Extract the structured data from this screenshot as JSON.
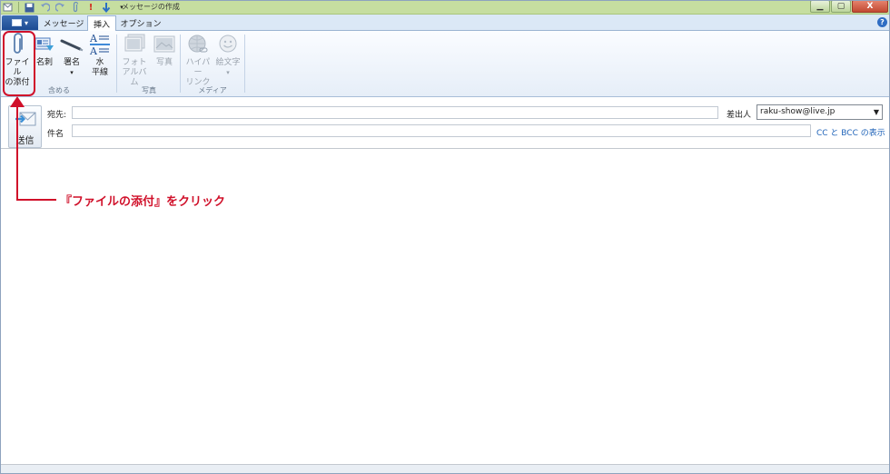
{
  "window": {
    "title": "メッセージの作成"
  },
  "title_buttons": {
    "minimize": "▁",
    "maximize": "▢",
    "close": "X"
  },
  "tabs": [
    {
      "label": "メッセージ"
    },
    {
      "label": "挿入",
      "active": true
    },
    {
      "label": "オプション"
    }
  ],
  "ribbon": {
    "groups": [
      {
        "label": "含める",
        "buttons": [
          {
            "label1": "ファイル",
            "label2": "の添付",
            "icon": "paperclip-icon"
          },
          {
            "label1": "名刺",
            "label2": "",
            "icon": "business-card-icon"
          },
          {
            "label1": "署名",
            "label2": "▾",
            "icon": "signature-pen-icon"
          },
          {
            "label1": "水",
            "label2": "平線",
            "icon": "horizontal-line-icon"
          }
        ]
      },
      {
        "label": "写真",
        "buttons": [
          {
            "label1": "フォト",
            "label2": "アルバム",
            "icon": "photo-album-icon",
            "disabled": true
          },
          {
            "label1": "写真",
            "label2": "",
            "icon": "photo-icon",
            "disabled": true
          }
        ]
      },
      {
        "label": "メディア",
        "buttons": [
          {
            "label1": "ハイパー",
            "label2": "リンク",
            "icon": "hyperlink-globe-icon",
            "disabled": true
          },
          {
            "label1": "絵文字",
            "label2": "▾",
            "icon": "emoticon-icon",
            "disabled": true
          }
        ]
      }
    ]
  },
  "compose": {
    "send_label": "送信",
    "to_label": "宛先:",
    "to_value": "",
    "subject_label": "件名",
    "subject_value": "",
    "from_label": "差出人",
    "from_value": "raku-show@live.jp",
    "cc_bcc_link": "CC と BCC の表示"
  },
  "annotation": {
    "text": "『ファイルの添付』をクリック",
    "color": "#d0102a"
  },
  "colors": {
    "titlebar": "#c6dea0",
    "tab_row": "#dbe8f6",
    "app_menu": "#1c4b93",
    "link": "#1f63b8"
  }
}
